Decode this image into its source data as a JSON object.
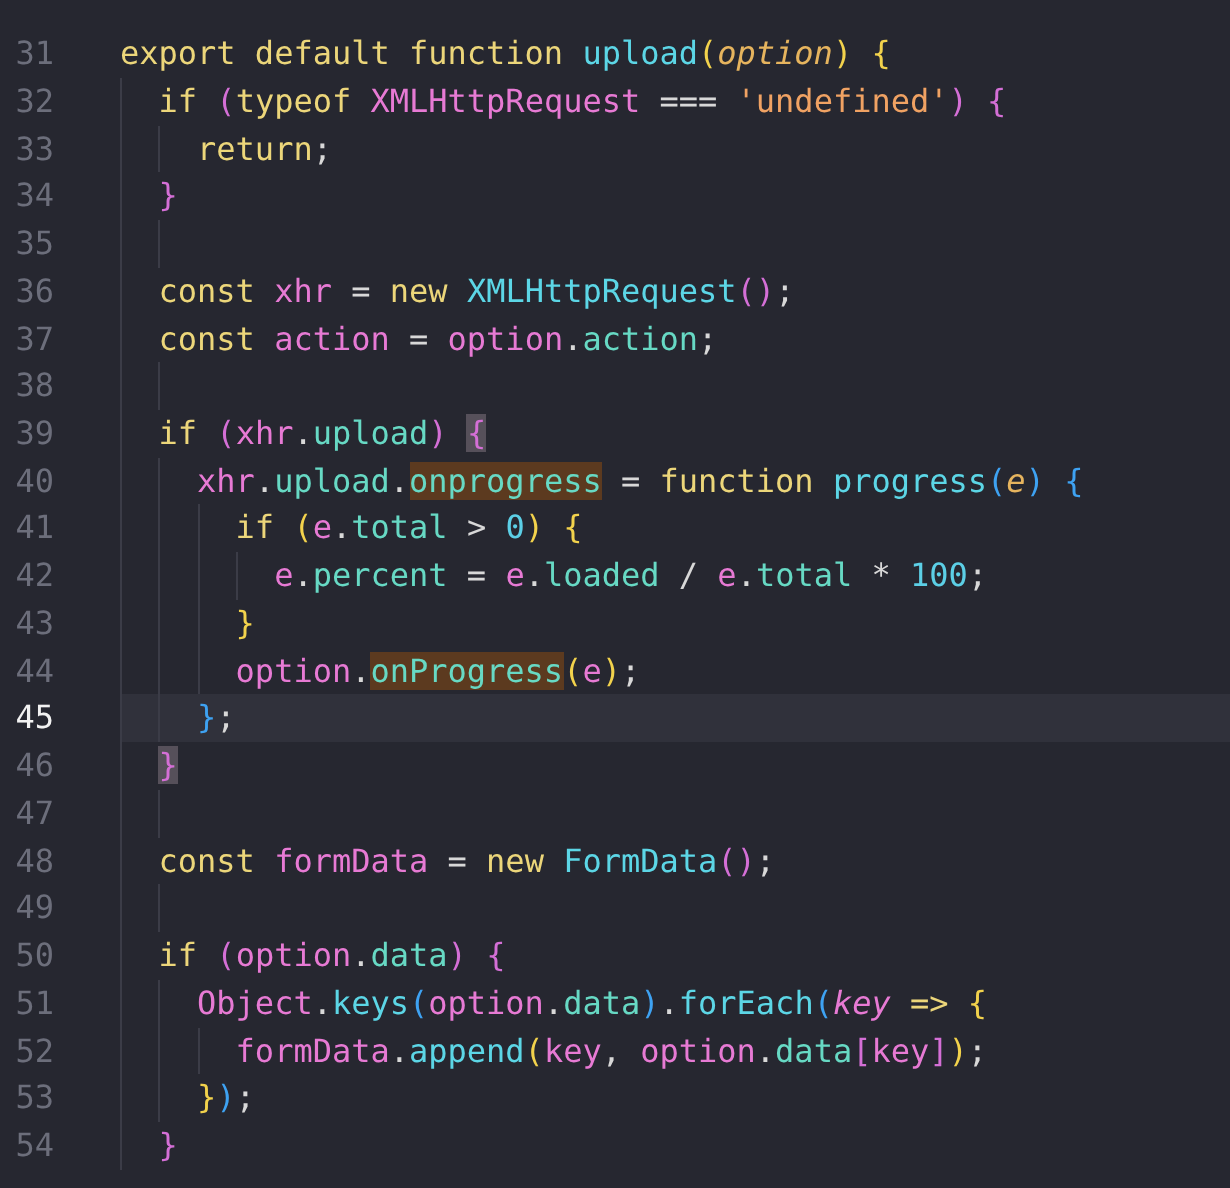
{
  "editor": {
    "lines": [
      {
        "number": "31",
        "current": false,
        "tokens": [
          {
            "text": "export default function",
            "kind": "kw"
          },
          {
            "text": " upload",
            "kind": "fn"
          },
          {
            "text": "(",
            "kind": "b1"
          },
          {
            "text": "option",
            "kind": "param"
          },
          {
            "text": ")",
            "kind": "b1"
          },
          {
            "text": " {",
            "kind": "b1"
          }
        ]
      },
      {
        "number": "32",
        "current": false,
        "tokens": [
          {
            "text": "  if",
            "kind": "kw"
          },
          {
            "text": " (",
            "kind": "b2"
          },
          {
            "text": "typeof",
            "kind": "kw"
          },
          {
            "text": " XMLHttpRequest",
            "kind": "var"
          },
          {
            "text": " === ",
            "kind": "plain"
          },
          {
            "text": "'undefined'",
            "kind": "str"
          },
          {
            "text": ")",
            "kind": "b2"
          },
          {
            "text": " {",
            "kind": "b2"
          }
        ]
      },
      {
        "number": "33",
        "current": false,
        "tokens": [
          {
            "text": "    return",
            "kind": "kw"
          },
          {
            "text": ";",
            "kind": "plain"
          }
        ]
      },
      {
        "number": "34",
        "current": false,
        "tokens": [
          {
            "text": "  }",
            "kind": "b2"
          }
        ]
      },
      {
        "number": "35",
        "current": false
      },
      {
        "number": "36",
        "current": false,
        "tokens": [
          {
            "text": "  const",
            "kind": "kw"
          },
          {
            "text": " xhr",
            "kind": "var"
          },
          {
            "text": " = ",
            "kind": "plain"
          },
          {
            "text": "new",
            "kind": "kw"
          },
          {
            "text": " XMLHttpRequest",
            "kind": "fn"
          },
          {
            "text": "()",
            "kind": "b2"
          },
          {
            "text": ";",
            "kind": "plain"
          }
        ]
      },
      {
        "number": "37",
        "current": false,
        "tokens": [
          {
            "text": "  const",
            "kind": "kw"
          },
          {
            "text": " action",
            "kind": "var"
          },
          {
            "text": " = ",
            "kind": "plain"
          },
          {
            "text": "option",
            "kind": "var"
          },
          {
            "text": ".",
            "kind": "plain"
          },
          {
            "text": "action",
            "kind": "prop"
          },
          {
            "text": ";",
            "kind": "plain"
          }
        ]
      },
      {
        "number": "38",
        "current": false
      },
      {
        "number": "39",
        "current": false,
        "tokens": [
          {
            "text": "  if",
            "kind": "kw"
          },
          {
            "text": " (",
            "kind": "b2"
          },
          {
            "text": "xhr",
            "kind": "var"
          },
          {
            "text": ".",
            "kind": "plain"
          },
          {
            "text": "upload",
            "kind": "prop"
          },
          {
            "text": ")",
            "kind": "b2"
          },
          {
            "text": " {",
            "kind": "match"
          }
        ]
      },
      {
        "number": "40",
        "current": false,
        "tokens": [
          {
            "text": "    xhr",
            "kind": "var"
          },
          {
            "text": ".",
            "kind": "plain"
          },
          {
            "text": "upload",
            "kind": "prop"
          },
          {
            "text": ".",
            "kind": "plain"
          },
          {
            "text": "onprogress",
            "kind": "occurrence"
          },
          {
            "text": " = ",
            "kind": "plain"
          },
          {
            "text": "function",
            "kind": "kw"
          },
          {
            "text": " progress",
            "kind": "fn"
          },
          {
            "text": "(",
            "kind": "b3"
          },
          {
            "text": "e",
            "kind": "param"
          },
          {
            "text": ")",
            "kind": "b3"
          },
          {
            "text": " {",
            "kind": "b3"
          }
        ]
      },
      {
        "number": "41",
        "current": false,
        "tokens": [
          {
            "text": "      if",
            "kind": "kw"
          },
          {
            "text": " (",
            "kind": "b1"
          },
          {
            "text": "e",
            "kind": "var"
          },
          {
            "text": ".",
            "kind": "plain"
          },
          {
            "text": "total",
            "kind": "prop"
          },
          {
            "text": " > ",
            "kind": "plain"
          },
          {
            "text": "0",
            "kind": "num"
          },
          {
            "text": ")",
            "kind": "b1"
          },
          {
            "text": " {",
            "kind": "b1"
          }
        ]
      },
      {
        "number": "42",
        "current": false,
        "tokens": [
          {
            "text": "        e",
            "kind": "var"
          },
          {
            "text": ".",
            "kind": "plain"
          },
          {
            "text": "percent",
            "kind": "prop"
          },
          {
            "text": " = ",
            "kind": "plain"
          },
          {
            "text": "e",
            "kind": "var"
          },
          {
            "text": ".",
            "kind": "plain"
          },
          {
            "text": "loaded",
            "kind": "prop"
          },
          {
            "text": " / ",
            "kind": "plain"
          },
          {
            "text": "e",
            "kind": "var"
          },
          {
            "text": ".",
            "kind": "plain"
          },
          {
            "text": "total",
            "kind": "prop"
          },
          {
            "text": " * ",
            "kind": "plain"
          },
          {
            "text": "100",
            "kind": "num"
          },
          {
            "text": ";",
            "kind": "plain"
          }
        ]
      },
      {
        "number": "43",
        "current": false,
        "tokens": [
          {
            "text": "      }",
            "kind": "b1"
          }
        ]
      },
      {
        "number": "44",
        "current": false,
        "tokens": [
          {
            "text": "      option",
            "kind": "var"
          },
          {
            "text": ".",
            "kind": "plain"
          },
          {
            "text": "onProgress",
            "kind": "occurrence"
          },
          {
            "text": "(",
            "kind": "b1"
          },
          {
            "text": "e",
            "kind": "var"
          },
          {
            "text": ")",
            "kind": "b1"
          },
          {
            "text": ";",
            "kind": "plain"
          }
        ]
      },
      {
        "number": "45",
        "current": true,
        "tokens": [
          {
            "text": "    }",
            "kind": "b3"
          },
          {
            "text": ";",
            "kind": "plain"
          }
        ]
      },
      {
        "number": "46",
        "current": false,
        "tokens": [
          {
            "text": "  }",
            "kind": "match"
          }
        ]
      },
      {
        "number": "47",
        "current": false
      },
      {
        "number": "48",
        "current": false,
        "tokens": [
          {
            "text": "  const",
            "kind": "kw"
          },
          {
            "text": " formData",
            "kind": "var"
          },
          {
            "text": " = ",
            "kind": "plain"
          },
          {
            "text": "new",
            "kind": "kw"
          },
          {
            "text": " FormData",
            "kind": "fn"
          },
          {
            "text": "()",
            "kind": "b2"
          },
          {
            "text": ";",
            "kind": "plain"
          }
        ]
      },
      {
        "number": "49",
        "current": false
      },
      {
        "number": "50",
        "current": false,
        "tokens": [
          {
            "text": "  if",
            "kind": "kw"
          },
          {
            "text": " (",
            "kind": "b2"
          },
          {
            "text": "option",
            "kind": "var"
          },
          {
            "text": ".",
            "kind": "plain"
          },
          {
            "text": "data",
            "kind": "prop"
          },
          {
            "text": ")",
            "kind": "b2"
          },
          {
            "text": " {",
            "kind": "b2"
          }
        ]
      },
      {
        "number": "51",
        "current": false,
        "tokens": [
          {
            "text": "    Object",
            "kind": "var"
          },
          {
            "text": ".",
            "kind": "plain"
          },
          {
            "text": "keys",
            "kind": "fn"
          },
          {
            "text": "(",
            "kind": "b3"
          },
          {
            "text": "option",
            "kind": "var"
          },
          {
            "text": ".",
            "kind": "plain"
          },
          {
            "text": "data",
            "kind": "prop"
          },
          {
            "text": ")",
            "kind": "b3"
          },
          {
            "text": ".",
            "kind": "plain"
          },
          {
            "text": "forEach",
            "kind": "fn"
          },
          {
            "text": "(",
            "kind": "b3"
          },
          {
            "text": "key",
            "kind": "arg"
          },
          {
            "text": " =>",
            "kind": "kw"
          },
          {
            "text": " {",
            "kind": "b1"
          }
        ]
      },
      {
        "number": "52",
        "current": false,
        "tokens": [
          {
            "text": "      formData",
            "kind": "var"
          },
          {
            "text": ".",
            "kind": "plain"
          },
          {
            "text": "append",
            "kind": "fn"
          },
          {
            "text": "(",
            "kind": "b1"
          },
          {
            "text": "key",
            "kind": "var"
          },
          {
            "text": ", ",
            "kind": "plain"
          },
          {
            "text": "option",
            "kind": "var"
          },
          {
            "text": ".",
            "kind": "plain"
          },
          {
            "text": "data",
            "kind": "prop"
          },
          {
            "text": "[",
            "kind": "b2"
          },
          {
            "text": "key",
            "kind": "var"
          },
          {
            "text": "]",
            "kind": "b2"
          },
          {
            "text": ")",
            "kind": "b1"
          },
          {
            "text": ";",
            "kind": "plain"
          }
        ]
      },
      {
        "number": "53",
        "current": false,
        "tokens": [
          {
            "text": "    }",
            "kind": "b1"
          },
          {
            "text": ")",
            "kind": "b3"
          },
          {
            "text": ";",
            "kind": "plain"
          }
        ]
      },
      {
        "number": "54",
        "current": false,
        "tokens": [
          {
            "text": "  }",
            "kind": "b2"
          }
        ]
      }
    ]
  }
}
